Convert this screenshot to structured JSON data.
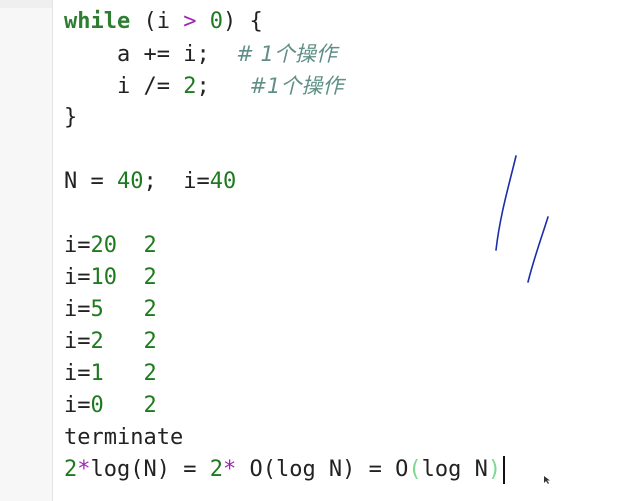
{
  "code": {
    "l1": {
      "kw": "while",
      "a": " (i ",
      "op": ">",
      "b": " ",
      "n": "0",
      "c": ") {"
    },
    "l2": {
      "code": "    a += i;  ",
      "comment": "# 1个操作"
    },
    "l3": {
      "a": "    i /= ",
      "n": "2",
      "b": ";   ",
      "comment": "#1个操作"
    },
    "l4": "}",
    "l6": {
      "a": "N = ",
      "n1": "40",
      "b": ";  i=",
      "n2": "40"
    },
    "trace": [
      {
        "label": "i=",
        "v": "20",
        "pad": "  ",
        "ops": "2"
      },
      {
        "label": "i=",
        "v": "10",
        "pad": "  ",
        "ops": "2"
      },
      {
        "label": "i=",
        "v": "5",
        "pad": "   ",
        "ops": "2"
      },
      {
        "label": "i=",
        "v": "2",
        "pad": "   ",
        "ops": "2"
      },
      {
        "label": "i=",
        "v": "1",
        "pad": "   ",
        "ops": "2"
      },
      {
        "label": "i=",
        "v": "0",
        "pad": "   ",
        "ops": "2"
      }
    ],
    "terminate": "terminate",
    "final": {
      "n": "2",
      "s1": "*",
      "t1": "log(N) = ",
      "n2": "2",
      "s2": "*",
      "t2": " O(log N) = O",
      "lp": "(",
      "t3": "log N",
      "rp": ")"
    }
  },
  "colors": {
    "keyword": "#2e7d32",
    "number": "#1e7a1e",
    "operator": "#9c27b0",
    "comment": "#5f8f86",
    "ink": "#1a2ea8"
  }
}
